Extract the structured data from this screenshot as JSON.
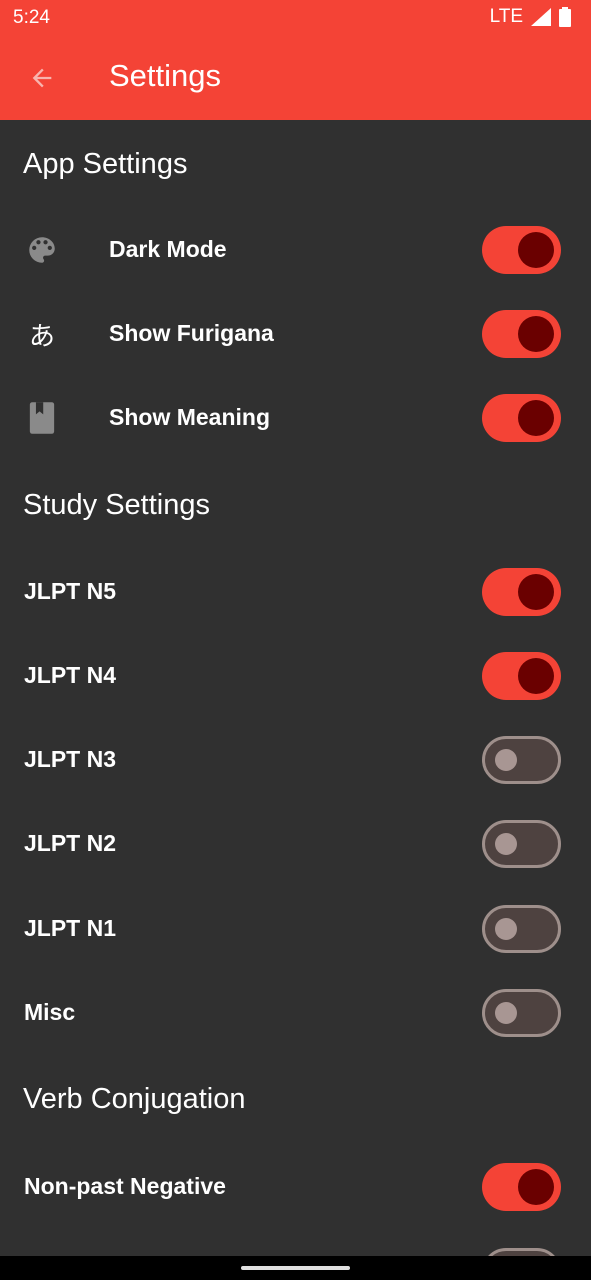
{
  "status": {
    "time": "5:24",
    "network": "LTE",
    "signal_icon": "signal-icon",
    "battery_icon": "battery-icon"
  },
  "appbar": {
    "title": "Settings",
    "back_icon": "arrow-back-icon",
    "color": "#f44336"
  },
  "app_settings": {
    "title": "App Settings",
    "items": [
      {
        "label": "Dark Mode",
        "icon": "palette-icon",
        "on": true
      },
      {
        "label": "Show Furigana",
        "icon": "あ",
        "on": true
      },
      {
        "label": "Show Meaning",
        "icon": "book-icon",
        "on": true
      }
    ]
  },
  "study_settings": {
    "title": "Study Settings",
    "items": [
      {
        "label": "JLPT N5",
        "on": true
      },
      {
        "label": "JLPT N4",
        "on": true
      },
      {
        "label": "JLPT N3",
        "on": false
      },
      {
        "label": "JLPT N2",
        "on": false
      },
      {
        "label": "JLPT N1",
        "on": false
      },
      {
        "label": "Misc",
        "on": false
      }
    ]
  },
  "verb_conjugation": {
    "title": "Verb Conjugation",
    "items": [
      {
        "label": "Non-past Negative",
        "on": true
      },
      {
        "label": "",
        "on": false
      }
    ]
  },
  "colors": {
    "accent": "#f44336",
    "background": "#303030",
    "thumb_on": "#6a0000"
  }
}
